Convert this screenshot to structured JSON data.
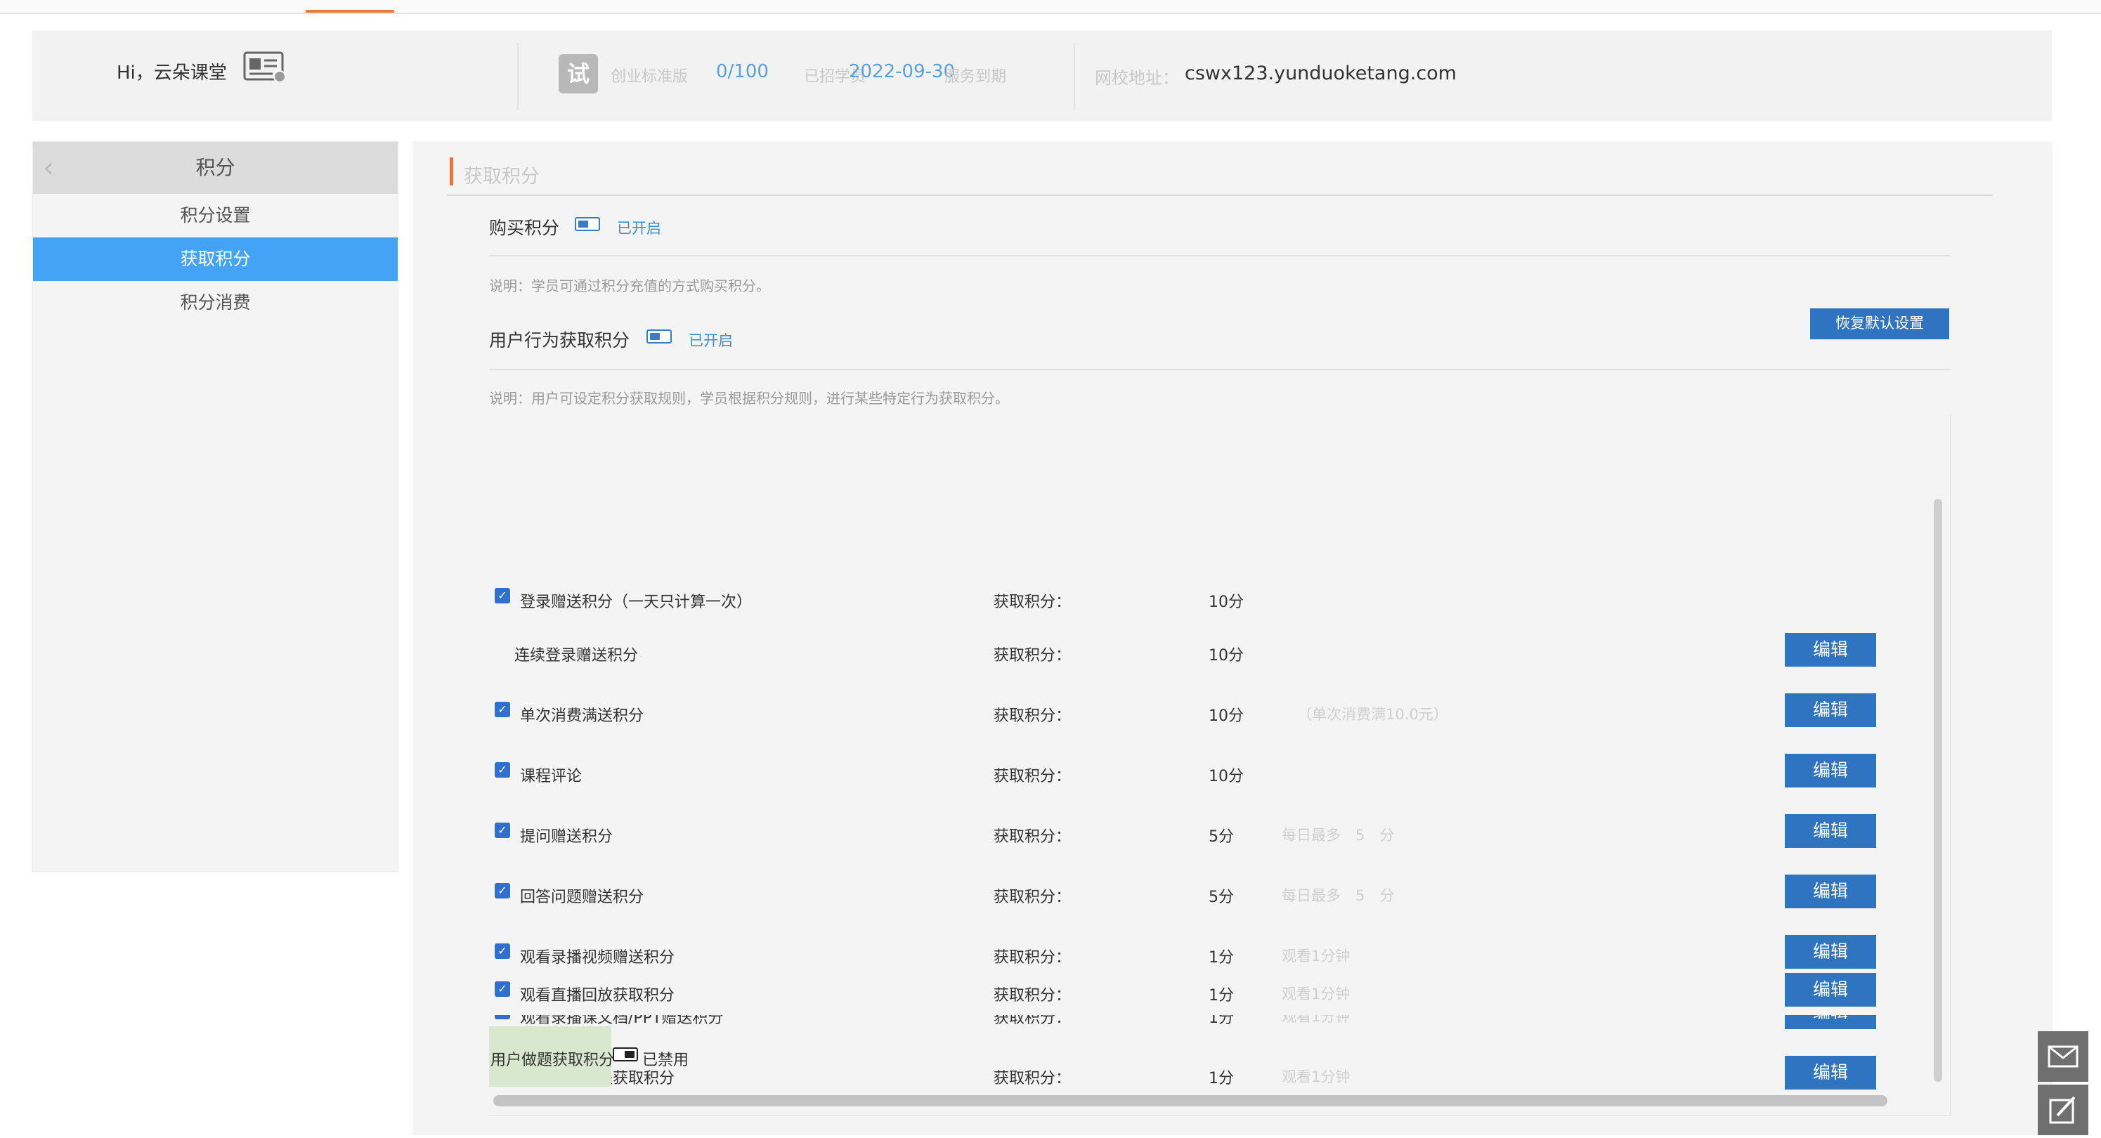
{
  "header": {
    "greeting": "Hi，云朵课堂",
    "trial_badge": "试",
    "plan": "创业标准版",
    "students_count": "0/100",
    "students_label": "已招学员",
    "expire_date": "2022-09-30",
    "expire_label": "服务到期",
    "school_url_label": "网校地址：",
    "school_url": "cswx123.yunduoketang.com"
  },
  "sidebar": {
    "title": "积分",
    "items": [
      {
        "label": "积分设置",
        "active": false
      },
      {
        "label": "获取积分",
        "active": true
      },
      {
        "label": "积分消费",
        "active": false
      }
    ]
  },
  "main": {
    "section_title": "获取积分",
    "purchase": {
      "label": "购买积分",
      "status": "已开启",
      "desc": "说明：学员可通过积分充值的方式购买积分。"
    },
    "behavior": {
      "label": "用户行为获取积分",
      "status": "已开启",
      "restore_button": "恢复默认设置",
      "desc": "说明：用户可设定积分获取规则，学员根据积分规则，进行某些特定行为获取积分。"
    },
    "rules": [
      {
        "name": "登录赠送积分（一天只计算一次）",
        "checked": true,
        "label": "获取积分：",
        "points": "10分",
        "hint": "",
        "edit": ""
      },
      {
        "name": "连续登录赠送积分",
        "checked": false,
        "label": "获取积分：",
        "points": "10分",
        "hint": "",
        "edit": "编辑"
      },
      {
        "name": "单次消费满送积分",
        "checked": true,
        "label": "获取积分：",
        "points": "10分",
        "hint": "（单次消费满10.0元）",
        "edit": "编辑"
      },
      {
        "name": "课程评论",
        "checked": true,
        "label": "获取积分：",
        "points": "10分",
        "hint": "",
        "edit": "编辑"
      },
      {
        "name": "提问赠送积分",
        "checked": true,
        "label": "获取积分：",
        "points": "5分",
        "hint": "每日最多　5　分",
        "edit": "编辑"
      },
      {
        "name": "回答问题赠送积分",
        "checked": true,
        "label": "获取积分：",
        "points": "5分",
        "hint": "每日最多　5　分",
        "edit": "编辑"
      },
      {
        "name": "观看录播视频赠送积分",
        "checked": true,
        "label": "获取积分：",
        "points": "1分",
        "hint": "观看1分钟",
        "edit": "编辑"
      },
      {
        "name": "观看录播课文档/PPT赠送积分",
        "checked": true,
        "label": "获取积分：",
        "points": "1分",
        "hint": "观看1分钟",
        "edit": "编辑"
      },
      {
        "name": "观看直播课程获取积分",
        "checked": true,
        "label": "获取积分：",
        "points": "1分",
        "hint": "观看1分钟",
        "edit": "编辑"
      },
      {
        "name": "观看直播回放获取积分",
        "checked": true,
        "label": "获取积分：",
        "points": "1分",
        "hint": "观看1分钟",
        "edit": "编辑"
      }
    ],
    "quiz": {
      "label": "用户做题获取积分",
      "status": "已禁用"
    }
  },
  "floating": {
    "mail_icon": "mail-icon",
    "edit_icon": "edit-note-icon"
  }
}
